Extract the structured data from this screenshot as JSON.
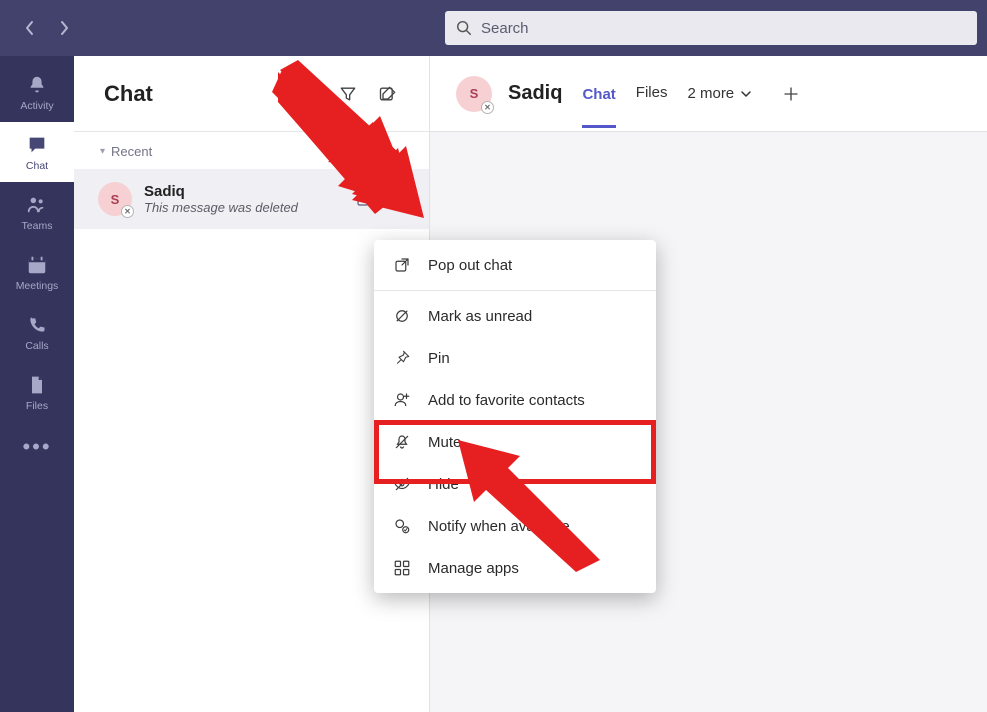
{
  "search": {
    "placeholder": "Search"
  },
  "rail": {
    "items": [
      {
        "label": "Activity"
      },
      {
        "label": "Chat"
      },
      {
        "label": "Teams"
      },
      {
        "label": "Meetings"
      },
      {
        "label": "Calls"
      },
      {
        "label": "Files"
      }
    ]
  },
  "list": {
    "title": "Chat",
    "section": "Recent",
    "chat": {
      "initial": "S",
      "name": "Sadiq",
      "subtitle": "This message was deleted"
    }
  },
  "conv": {
    "avatar_initial": "S",
    "title": "Sadiq",
    "tabs": {
      "chat": "Chat",
      "files": "Files",
      "more": "2 more"
    }
  },
  "menu": {
    "popout": "Pop out chat",
    "unread": "Mark as unread",
    "pin": "Pin",
    "fav": "Add to favorite contacts",
    "mute": "Mute",
    "hide": "Hide",
    "notify": "Notify when available",
    "apps": "Manage apps"
  }
}
